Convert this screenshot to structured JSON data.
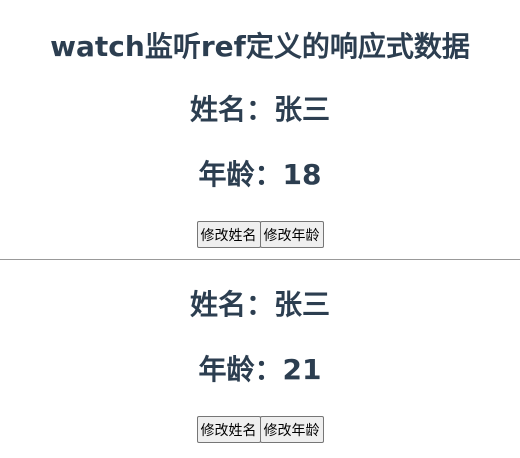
{
  "page": {
    "title": "watch监听ref定义的响应式数据"
  },
  "section_one": {
    "name_label": "姓名：",
    "name_value": "张三",
    "age_label": "年龄：",
    "age_value": "18",
    "change_name_button": "修改姓名",
    "change_age_button": "修改年龄"
  },
  "section_two": {
    "name_label": "姓名：",
    "name_value": "张三",
    "age_label": "年龄：",
    "age_value": "21",
    "change_name_button": "修改姓名",
    "change_age_button": "修改年龄"
  },
  "colors": {
    "text": "#2c3e50",
    "divider": "#999999",
    "button_bg": "#efefef"
  }
}
